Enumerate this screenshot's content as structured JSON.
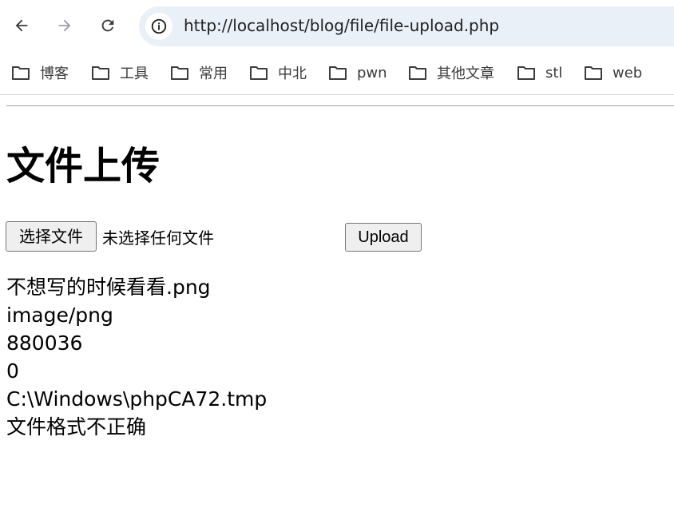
{
  "browser": {
    "url": "http://localhost/blog/file/file-upload.php",
    "bookmarks": [
      "博客",
      "工具",
      "常用",
      "中北",
      "pwn",
      "其他文章",
      "stl",
      "web"
    ]
  },
  "page": {
    "title": "文件上传",
    "file_button_label": "选择文件",
    "file_status": "未选择任何文件",
    "upload_button_label": "Upload",
    "output_lines": [
      "不想写的时候看看.png",
      "image/png",
      "880036",
      "0",
      "C:\\Windows\\phpCA72.tmp",
      "文件格式不正确"
    ]
  }
}
